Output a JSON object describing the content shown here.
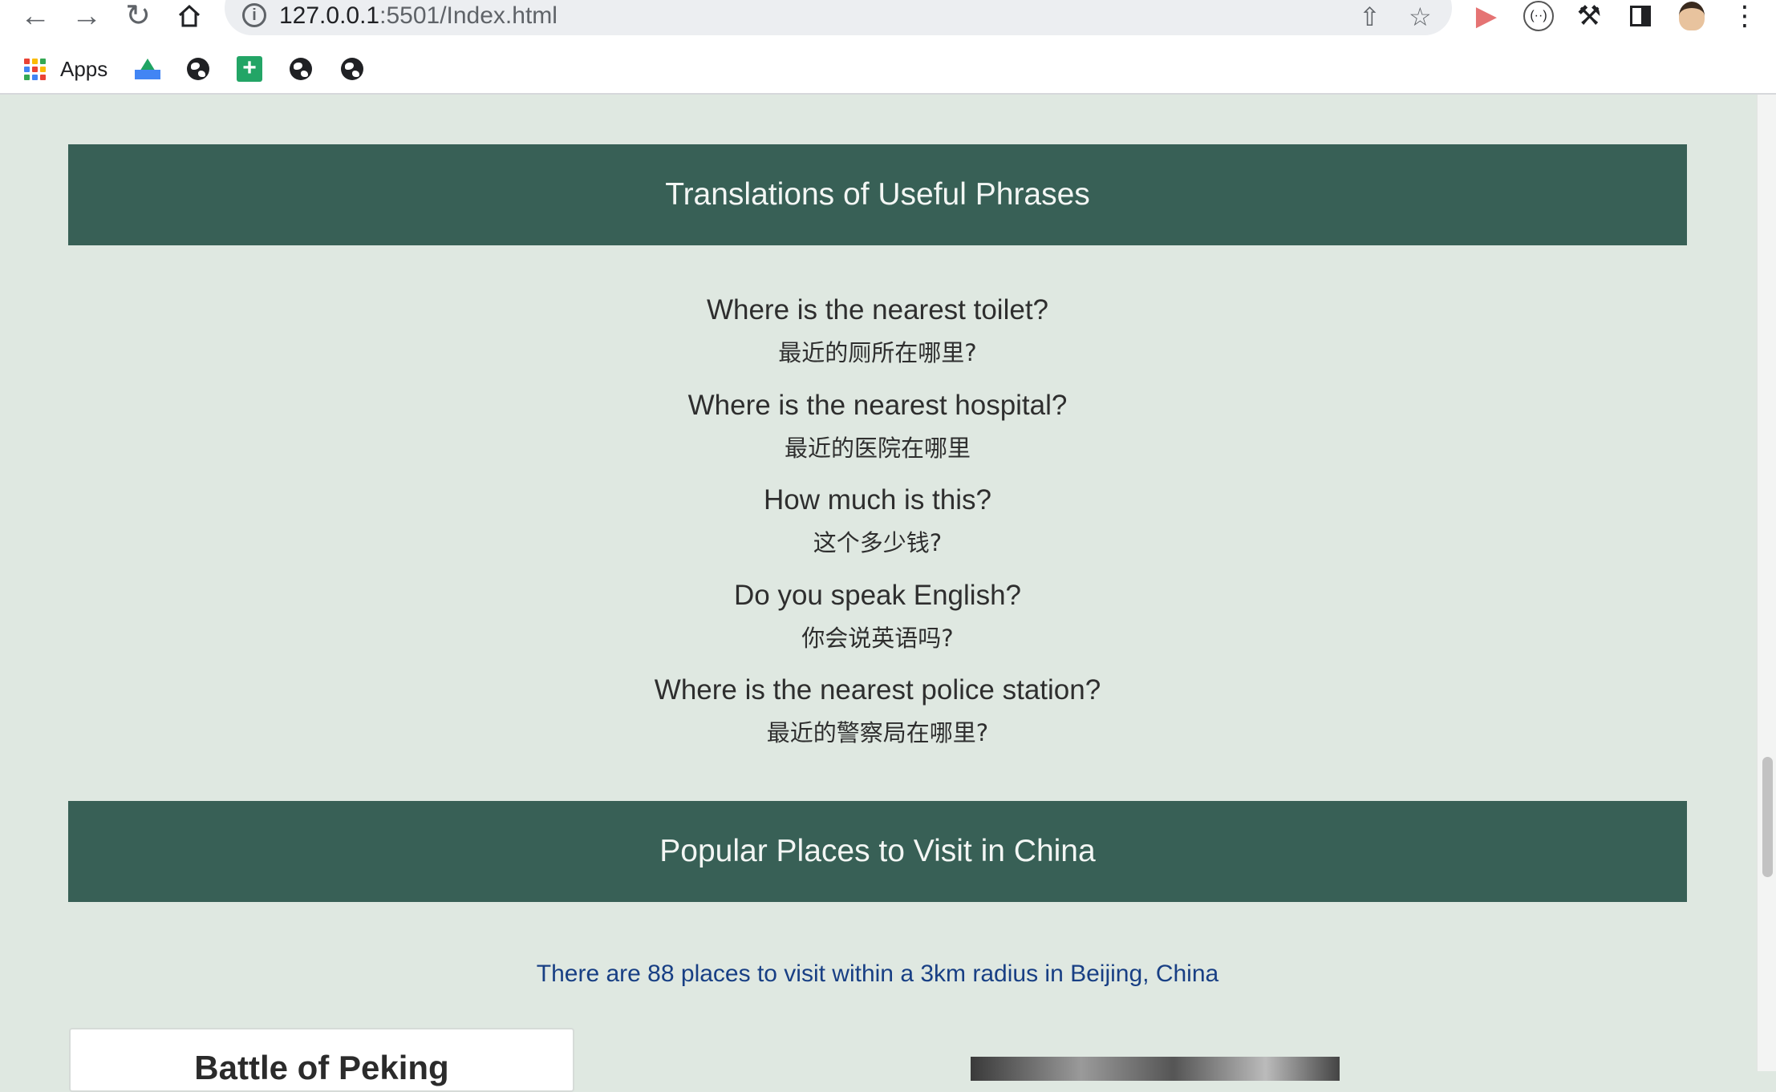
{
  "browser": {
    "url_host": "127.0.0.1",
    "url_path": ":5501/Index.html",
    "bookmarks": {
      "apps_label": "Apps"
    },
    "icons": {
      "back": "back-arrow-icon",
      "forward": "forward-arrow-icon",
      "reload": "reload-icon",
      "home": "home-icon",
      "info": "info-icon",
      "share": "share-icon",
      "star": "star-icon",
      "extensions": "puzzle-icon",
      "sidepanel": "side-panel-icon",
      "menu": "kebab-menu-icon"
    }
  },
  "page": {
    "phrases_heading": "Translations of Useful Phrases",
    "phrases": [
      {
        "en": "Where is the nearest toilet?",
        "zh": "最近的厕所在哪里?"
      },
      {
        "en": "Where is the nearest hospital?",
        "zh": "最近的医院在哪里"
      },
      {
        "en": "How much is this?",
        "zh": "这个多少钱?"
      },
      {
        "en": "Do you speak English?",
        "zh": "你会说英语吗?"
      },
      {
        "en": "Where is the nearest police station?",
        "zh": "最近的警察局在哪里?"
      }
    ],
    "places_heading": "Popular Places to Visit in China",
    "places_summary": "There are 88 places to visit within a 3km radius in Beijing, China",
    "first_card_title": "Battle of Peking"
  },
  "colors": {
    "page_background": "#dfe8e1",
    "banner_background": "#386056",
    "summary_text": "#183f84"
  }
}
